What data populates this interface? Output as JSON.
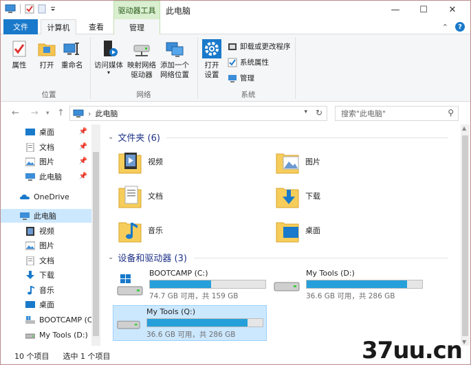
{
  "window": {
    "title": "此电脑",
    "context_tab_title": "驱动器工具",
    "controls": {
      "minimize": "—",
      "maximize": "☐",
      "close": "✕"
    }
  },
  "tabs": {
    "file": "文件",
    "computer": "计算机",
    "view": "查看",
    "manage": "管理",
    "expand_chevron": "⌃",
    "help": "?"
  },
  "ribbon": {
    "location_group": {
      "label": "位置",
      "properties": "属性",
      "open": "打开",
      "rename": "重命名"
    },
    "network_group": {
      "label": "网络",
      "access_media": "访问媒体",
      "map_drive_line1": "映射网络",
      "map_drive_line2": "驱动器",
      "add_location_line1": "添加一个",
      "add_location_line2": "网络位置"
    },
    "system_group": {
      "label": "系统",
      "open_settings_line1": "打开",
      "open_settings_line2": "设置",
      "uninstall": "卸载或更改程序",
      "system_properties": "系统属性",
      "manage": "管理"
    }
  },
  "address": {
    "path": "此电脑",
    "search_placeholder": "搜索\"此电脑\""
  },
  "nav": {
    "items": [
      {
        "label": "桌面",
        "pinned": true
      },
      {
        "label": "文档",
        "pinned": true
      },
      {
        "label": "图片",
        "pinned": true
      },
      {
        "label": "此电脑",
        "pinned": true
      },
      {
        "label": "OneDrive"
      },
      {
        "label": "此电脑",
        "selected": true
      },
      {
        "label": "视频"
      },
      {
        "label": "图片"
      },
      {
        "label": "文档"
      },
      {
        "label": "下载"
      },
      {
        "label": "音乐"
      },
      {
        "label": "桌面"
      },
      {
        "label": "BOOTCAMP (C"
      },
      {
        "label": "My Tools (D:)"
      }
    ]
  },
  "content": {
    "folders_header": "文件夹 (6)",
    "folders": [
      {
        "name": "视频"
      },
      {
        "name": "图片"
      },
      {
        "name": "文档"
      },
      {
        "name": "下载"
      },
      {
        "name": "音乐"
      },
      {
        "name": "桌面"
      }
    ],
    "devices_header": "设备和驱动器 (3)",
    "drives": [
      {
        "name": "BOOTCAMP (C:)",
        "free": "74.7 GB 可用，共 159 GB",
        "used_fraction": 0.53
      },
      {
        "name": "My Tools (D:)",
        "free": "36.6 GB 可用，共 286 GB",
        "used_fraction": 0.87
      },
      {
        "name": "My Tools (Q:)",
        "free": "36.6 GB 可用，共 286 GB",
        "used_fraction": 0.87,
        "selected": true
      }
    ]
  },
  "status": {
    "items_count": "10 个项目",
    "selected_count": "选中 1 个项目"
  },
  "watermark": "37uu.cn",
  "colors": {
    "accent": "#1979ca",
    "context_tab": "#d9efcf",
    "selection": "#cce8ff",
    "bar_fill": "#26a0da",
    "section_header": "#1e3287"
  }
}
